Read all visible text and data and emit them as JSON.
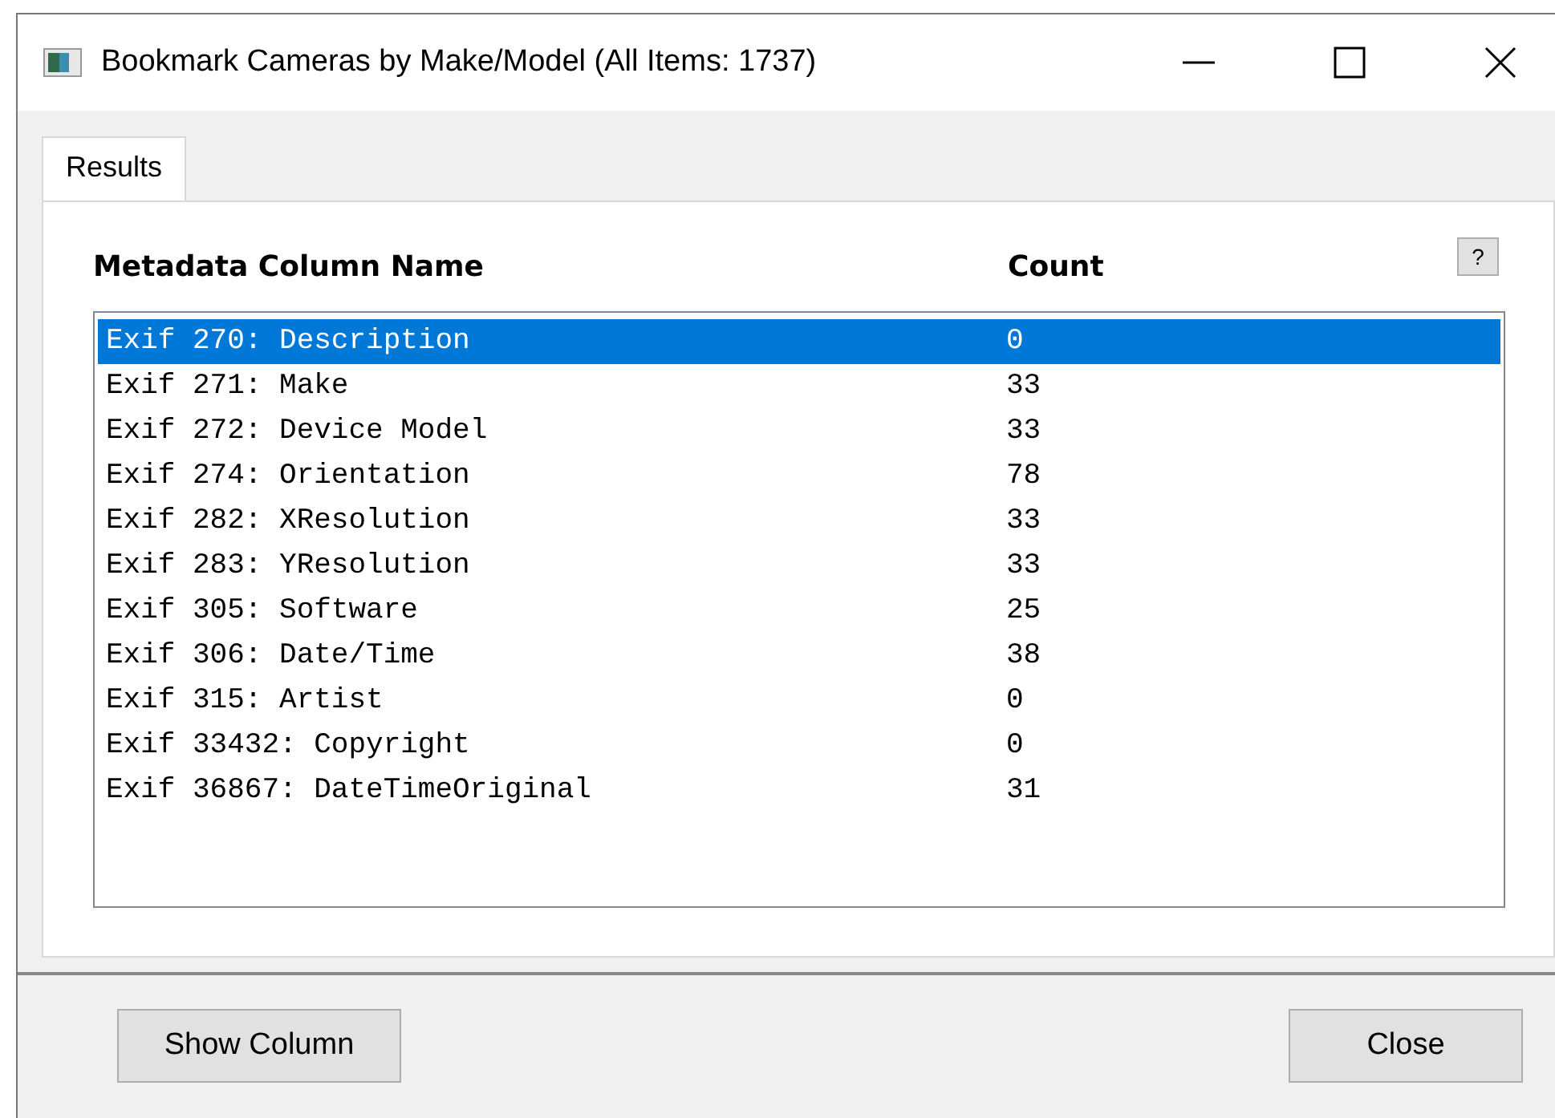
{
  "window": {
    "title": "Bookmark Cameras by Make/Model (All Items: 1737)"
  },
  "tabs": [
    {
      "label": "Results",
      "selected": true
    }
  ],
  "help_button": "?",
  "table": {
    "columns": [
      "Metadata Column Name",
      "Count"
    ],
    "rows": [
      {
        "name": "Exif 270: Description",
        "count": "0",
        "selected": true
      },
      {
        "name": "Exif 271: Make",
        "count": "33",
        "selected": false
      },
      {
        "name": "Exif 272: Device Model",
        "count": "33",
        "selected": false
      },
      {
        "name": "Exif 274: Orientation",
        "count": "78",
        "selected": false
      },
      {
        "name": "Exif 282: XResolution",
        "count": "33",
        "selected": false
      },
      {
        "name": "Exif 283: YResolution",
        "count": "33",
        "selected": false
      },
      {
        "name": "Exif 305: Software",
        "count": "25",
        "selected": false
      },
      {
        "name": "Exif 306: Date/Time",
        "count": "38",
        "selected": false
      },
      {
        "name": "Exif 315: Artist",
        "count": "0",
        "selected": false
      },
      {
        "name": "Exif 33432: Copyright",
        "count": "0",
        "selected": false
      },
      {
        "name": "Exif 36867: DateTimeOriginal",
        "count": "31",
        "selected": false
      }
    ]
  },
  "buttons": [
    "Show Column",
    "Close"
  ]
}
